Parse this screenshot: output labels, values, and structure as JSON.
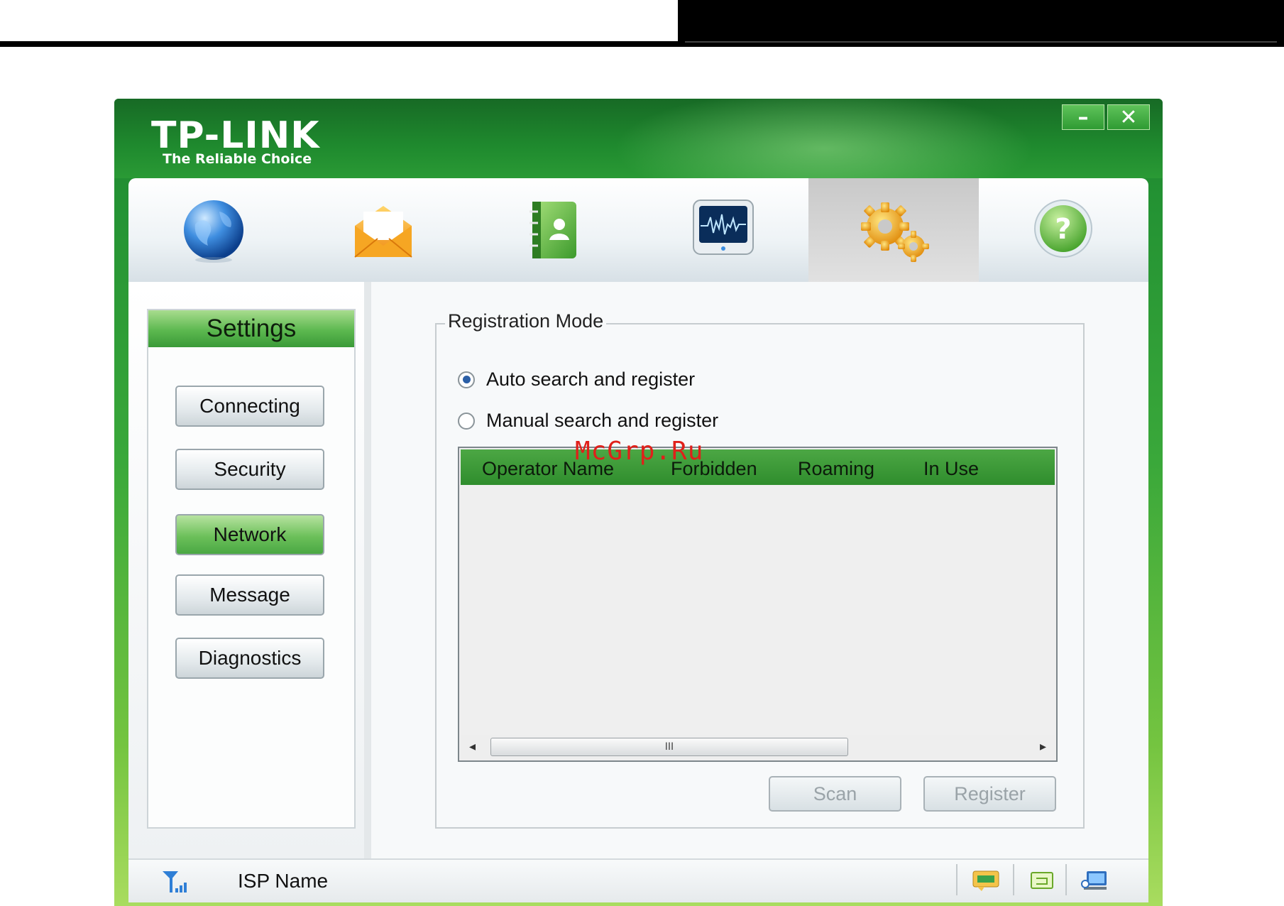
{
  "app": {
    "brand": "TP-LINK",
    "tagline": "The Reliable Choice",
    "window_buttons": {
      "minimize": "–",
      "close": "✕"
    }
  },
  "nav_tabs": [
    {
      "id": "internet",
      "icon": "globe-icon"
    },
    {
      "id": "messages",
      "icon": "envelope-icon"
    },
    {
      "id": "contacts",
      "icon": "contacts-book-icon"
    },
    {
      "id": "statistics",
      "icon": "monitor-waveform-icon"
    },
    {
      "id": "settings",
      "icon": "gears-icon",
      "active": true
    },
    {
      "id": "help",
      "icon": "help-question-icon"
    }
  ],
  "sidebar": {
    "title": "Settings",
    "items": [
      {
        "label": "Connecting"
      },
      {
        "label": "Security"
      },
      {
        "label": "Network",
        "active": true
      },
      {
        "label": "Message"
      },
      {
        "label": "Diagnostics"
      }
    ]
  },
  "registration": {
    "legend": "Registration Mode",
    "options": [
      {
        "label": "Auto search and register",
        "checked": true
      },
      {
        "label": "Manual search and register",
        "checked": false
      }
    ],
    "table": {
      "columns": [
        "Operator Name",
        "Forbidden",
        "Roaming",
        "In Use"
      ],
      "rows": [],
      "scroll_thumb_glyph": "III"
    },
    "buttons": {
      "scan": "Scan",
      "register": "Register"
    }
  },
  "watermark": "McGrp.Ru",
  "statusbar": {
    "isp_label": "ISP Name",
    "icons": [
      "signal-strength-icon",
      "sms-status-icon",
      "sim-icon",
      "network-connection-icon"
    ]
  },
  "colors": {
    "brand_green": "#1f8a2e",
    "accent_green": "#4ca744",
    "watermark_red": "#e0201a"
  }
}
